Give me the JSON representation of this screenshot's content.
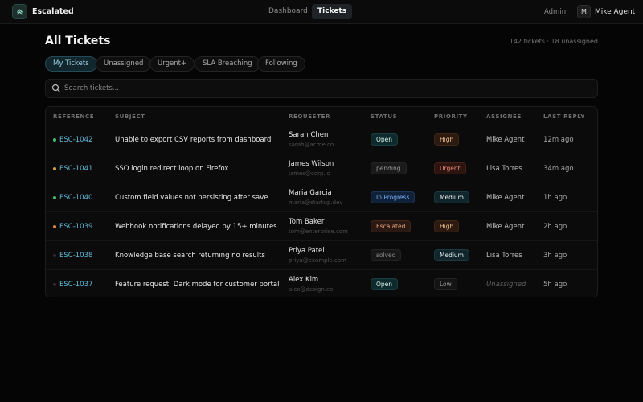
{
  "app": {
    "name": "Escalated",
    "icon": "chevrons-up-icon"
  },
  "nav": {
    "dashboard": "Dashboard",
    "tickets": "Tickets"
  },
  "user": {
    "role": "Admin",
    "initial": "M",
    "name": "Mike Agent"
  },
  "page": {
    "title": "All Tickets",
    "count": "142 tickets · 18 unassigned"
  },
  "filters": [
    "My Tickets",
    "Unassigned",
    "Urgent+",
    "SLA Breaching",
    "Following"
  ],
  "active_filter": "My Tickets",
  "search": {
    "placeholder": "Search tickets...",
    "icon": "search-icon"
  },
  "table": {
    "headers": [
      "REFERENCE",
      "SUBJECT",
      "REQUESTER",
      "STATUS",
      "PRIORITY",
      "ASSIGNEE",
      "LAST REPLY"
    ],
    "rows": [
      {
        "ref": "ESC-1042",
        "subject": "Unable to export CSV reports from dashboard",
        "name": "Sarah Chen",
        "email": "sarah@acme.co",
        "status": "Open",
        "priority": "High",
        "assignee": "Mike Agent",
        "reply": "12m ago",
        "dot": "#3fbf6a"
      },
      {
        "ref": "ESC-1041",
        "subject": "SSO login redirect loop on Firefox",
        "name": "James Wilson",
        "email": "james@corp.io",
        "status": "pending",
        "priority": "Urgent",
        "assignee": "Lisa Torres",
        "reply": "34m ago",
        "dot": "#d9a33a"
      },
      {
        "ref": "ESC-1040",
        "subject": "Custom field values not persisting after save",
        "name": "Maria Garcia",
        "email": "maria@startup.dev",
        "status": "In Progress",
        "priority": "Medium",
        "assignee": "Mike Agent",
        "reply": "1h ago",
        "dot": "#3fbf6a"
      },
      {
        "ref": "ESC-1039",
        "subject": "Webhook notifications delayed by 15+ minutes",
        "name": "Tom Baker",
        "email": "tom@enterprise.com",
        "status": "Escalated",
        "priority": "High",
        "assignee": "Mike Agent",
        "reply": "2h ago",
        "dot": "#d98a3a"
      },
      {
        "ref": "ESC-1038",
        "subject": "Knowledge base search returning no results",
        "name": "Priya Patel",
        "email": "priya@example.com",
        "status": "solved",
        "priority": "Medium",
        "assignee": "Lisa Torres",
        "reply": "3h ago",
        "dot": "#3a2a2a"
      },
      {
        "ref": "ESC-1037",
        "subject": "Feature request: Dark mode for customer portal",
        "name": "Alex Kim",
        "email": "alex@design.co",
        "status": "Open",
        "priority": "Low",
        "assignee": "Unassigned",
        "reply": "5h ago",
        "dot": "#3a2a2a"
      }
    ]
  },
  "colors": {
    "accent": "#5fb9d8",
    "status": {
      "Open": {
        "bg": "#0f2a2c",
        "fg": "#d6f3ea",
        "bd": "#17403f"
      },
      "pending": {
        "bg": "#1a1a1a",
        "fg": "#9a9a9a",
        "bd": "#262626"
      },
      "In Progress": {
        "bg": "#10223a",
        "fg": "#79aaf0",
        "bd": "#1b3556"
      },
      "Escalated": {
        "bg": "#2a1812",
        "fg": "#e7a47d",
        "bd": "#43261b"
      },
      "solved": {
        "bg": "#171717",
        "fg": "#8c8c8c",
        "bd": "#232323"
      }
    },
    "priority": {
      "High": {
        "bg": "#2c1a10",
        "fg": "#f1c08e",
        "bd": "#3e2616"
      },
      "Urgent": {
        "bg": "#2e1410",
        "fg": "#ef8f77",
        "bd": "#45201a"
      },
      "Medium": {
        "bg": "#11262c",
        "fg": "#e8f2f2",
        "bd": "#1a3a40"
      },
      "Low": {
        "bg": "#141414",
        "fg": "#9a9a9a",
        "bd": "#242424"
      }
    }
  }
}
